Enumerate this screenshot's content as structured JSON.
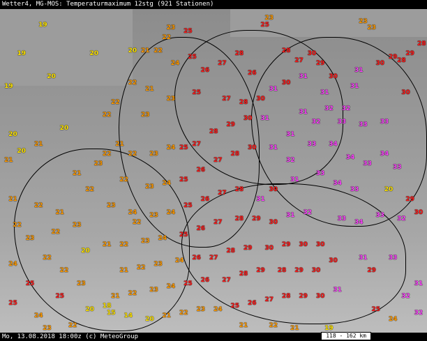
{
  "header": {
    "title": "Wetter4, MG-MOS: Temperaturmaximum 12stg (921 Stationen)"
  },
  "footer": {
    "timestamp": "Mo, 13.08.2018 18:00z (c) MeteoGroup",
    "scale": "118 - 162 km"
  },
  "colors": {
    "cool": "#ffe400",
    "warm": "#ff9a00",
    "hot": "#ff1a1a",
    "very_hot": "#ff44ff"
  },
  "stations": [
    [
      "19",
      0.09,
      0.04
    ],
    [
      "19",
      0.04,
      0.13
    ],
    [
      "20",
      0.21,
      0.13
    ],
    [
      "20",
      0.3,
      0.12
    ],
    [
      "21",
      0.33,
      0.12
    ],
    [
      "19",
      0.01,
      0.23
    ],
    [
      "20",
      0.11,
      0.2
    ],
    [
      "20",
      0.02,
      0.38
    ],
    [
      "21",
      0.01,
      0.46
    ],
    [
      "20",
      0.04,
      0.43
    ],
    [
      "21",
      0.08,
      0.41
    ],
    [
      "20",
      0.14,
      0.36
    ],
    [
      "22",
      0.24,
      0.32
    ],
    [
      "23",
      0.33,
      0.32
    ],
    [
      "21",
      0.17,
      0.5
    ],
    [
      "22",
      0.2,
      0.55
    ],
    [
      "23",
      0.25,
      0.6
    ],
    [
      "24",
      0.3,
      0.62
    ],
    [
      "22",
      0.38,
      0.08
    ],
    [
      "23",
      0.39,
      0.05
    ],
    [
      "25",
      0.43,
      0.06
    ],
    [
      "22",
      0.36,
      0.12
    ],
    [
      "24",
      0.4,
      0.16
    ],
    [
      "25",
      0.44,
      0.14
    ],
    [
      "26",
      0.47,
      0.18
    ],
    [
      "27",
      0.51,
      0.16
    ],
    [
      "28",
      0.55,
      0.13
    ],
    [
      "26",
      0.58,
      0.19
    ],
    [
      "25",
      0.61,
      0.04
    ],
    [
      "23",
      0.62,
      0.02
    ],
    [
      "28",
      0.66,
      0.12
    ],
    [
      "27",
      0.69,
      0.15
    ],
    [
      "30",
      0.72,
      0.13
    ],
    [
      "29",
      0.74,
      0.16
    ],
    [
      "30",
      0.77,
      0.2
    ],
    [
      "31",
      0.83,
      0.18
    ],
    [
      "30",
      0.88,
      0.16
    ],
    [
      "29",
      0.91,
      0.14
    ],
    [
      "28",
      0.93,
      0.15
    ],
    [
      "29",
      0.95,
      0.13
    ],
    [
      "28",
      0.98,
      0.1
    ],
    [
      "23",
      0.84,
      0.03
    ],
    [
      "23",
      0.86,
      0.05
    ],
    [
      "31",
      0.7,
      0.2
    ],
    [
      "30",
      0.66,
      0.22
    ],
    [
      "31",
      0.63,
      0.24
    ],
    [
      "30",
      0.6,
      0.27
    ],
    [
      "28",
      0.56,
      0.28
    ],
    [
      "27",
      0.52,
      0.27
    ],
    [
      "25",
      0.45,
      0.25
    ],
    [
      "23",
      0.39,
      0.27
    ],
    [
      "21",
      0.34,
      0.24
    ],
    [
      "22",
      0.3,
      0.22
    ],
    [
      "22",
      0.26,
      0.28
    ],
    [
      "31",
      0.75,
      0.25
    ],
    [
      "32",
      0.76,
      0.3
    ],
    [
      "32",
      0.8,
      0.3
    ],
    [
      "33",
      0.79,
      0.34
    ],
    [
      "33",
      0.84,
      0.35
    ],
    [
      "33",
      0.89,
      0.34
    ],
    [
      "30",
      0.94,
      0.25
    ],
    [
      "31",
      0.82,
      0.23
    ],
    [
      "32",
      0.73,
      0.34
    ],
    [
      "31",
      0.7,
      0.31
    ],
    [
      "31",
      0.61,
      0.33
    ],
    [
      "30",
      0.57,
      0.33
    ],
    [
      "29",
      0.53,
      0.35
    ],
    [
      "28",
      0.49,
      0.37
    ],
    [
      "27",
      0.45,
      0.41
    ],
    [
      "25",
      0.42,
      0.42
    ],
    [
      "24",
      0.39,
      0.42
    ],
    [
      "23",
      0.35,
      0.44
    ],
    [
      "22",
      0.3,
      0.44
    ],
    [
      "21",
      0.27,
      0.41
    ],
    [
      "22",
      0.24,
      0.44
    ],
    [
      "23",
      0.22,
      0.47
    ],
    [
      "31",
      0.67,
      0.38
    ],
    [
      "33",
      0.72,
      0.41
    ],
    [
      "34",
      0.77,
      0.41
    ],
    [
      "34",
      0.81,
      0.45
    ],
    [
      "33",
      0.85,
      0.47
    ],
    [
      "34",
      0.89,
      0.44
    ],
    [
      "33",
      0.92,
      0.48
    ],
    [
      "32",
      0.67,
      0.46
    ],
    [
      "31",
      0.63,
      0.42
    ],
    [
      "30",
      0.58,
      0.42
    ],
    [
      "28",
      0.54,
      0.44
    ],
    [
      "27",
      0.5,
      0.46
    ],
    [
      "26",
      0.46,
      0.49
    ],
    [
      "25",
      0.42,
      0.52
    ],
    [
      "24",
      0.38,
      0.53
    ],
    [
      "23",
      0.34,
      0.54
    ],
    [
      "22",
      0.28,
      0.52
    ],
    [
      "33",
      0.74,
      0.5
    ],
    [
      "34",
      0.78,
      0.53
    ],
    [
      "33",
      0.82,
      0.55
    ],
    [
      "31",
      0.68,
      0.52
    ],
    [
      "30",
      0.63,
      0.55
    ],
    [
      "31",
      0.6,
      0.58
    ],
    [
      "28",
      0.55,
      0.55
    ],
    [
      "27",
      0.51,
      0.56
    ],
    [
      "26",
      0.47,
      0.58
    ],
    [
      "25",
      0.43,
      0.6
    ],
    [
      "24",
      0.39,
      0.62
    ],
    [
      "23",
      0.35,
      0.63
    ],
    [
      "22",
      0.31,
      0.65
    ],
    [
      "20",
      0.9,
      0.55
    ],
    [
      "33",
      0.79,
      0.64
    ],
    [
      "34",
      0.83,
      0.65
    ],
    [
      "32",
      0.71,
      0.62
    ],
    [
      "31",
      0.67,
      0.63
    ],
    [
      "30",
      0.63,
      0.65
    ],
    [
      "29",
      0.59,
      0.64
    ],
    [
      "28",
      0.55,
      0.64
    ],
    [
      "27",
      0.5,
      0.65
    ],
    [
      "26",
      0.46,
      0.67
    ],
    [
      "25",
      0.42,
      0.69
    ],
    [
      "24",
      0.37,
      0.7
    ],
    [
      "23",
      0.33,
      0.71
    ],
    [
      "22",
      0.28,
      0.72
    ],
    [
      "21",
      0.24,
      0.72
    ],
    [
      "20",
      0.19,
      0.74
    ],
    [
      "33",
      0.88,
      0.63
    ],
    [
      "32",
      0.93,
      0.64
    ],
    [
      "30",
      0.74,
      0.72
    ],
    [
      "30",
      0.7,
      0.72
    ],
    [
      "29",
      0.66,
      0.72
    ],
    [
      "30",
      0.62,
      0.73
    ],
    [
      "29",
      0.57,
      0.73
    ],
    [
      "28",
      0.53,
      0.74
    ],
    [
      "27",
      0.49,
      0.76
    ],
    [
      "26",
      0.45,
      0.76
    ],
    [
      "24",
      0.41,
      0.77
    ],
    [
      "23",
      0.36,
      0.78
    ],
    [
      "22",
      0.32,
      0.79
    ],
    [
      "21",
      0.28,
      0.8
    ],
    [
      "30",
      0.77,
      0.77
    ],
    [
      "31",
      0.84,
      0.76
    ],
    [
      "33",
      0.91,
      0.76
    ],
    [
      "29",
      0.86,
      0.8
    ],
    [
      "30",
      0.73,
      0.8
    ],
    [
      "29",
      0.69,
      0.8
    ],
    [
      "28",
      0.65,
      0.8
    ],
    [
      "29",
      0.6,
      0.8
    ],
    [
      "28",
      0.56,
      0.81
    ],
    [
      "27",
      0.52,
      0.83
    ],
    [
      "26",
      0.47,
      0.83
    ],
    [
      "25",
      0.43,
      0.84
    ],
    [
      "24",
      0.39,
      0.85
    ],
    [
      "23",
      0.35,
      0.86
    ],
    [
      "22",
      0.3,
      0.87
    ],
    [
      "21",
      0.26,
      0.88
    ],
    [
      "18",
      0.24,
      0.91
    ],
    [
      "15",
      0.25,
      0.93
    ],
    [
      "14",
      0.29,
      0.94
    ],
    [
      "20",
      0.2,
      0.92
    ],
    [
      "31",
      0.78,
      0.86
    ],
    [
      "30",
      0.74,
      0.88
    ],
    [
      "29",
      0.7,
      0.88
    ],
    [
      "28",
      0.66,
      0.88
    ],
    [
      "27",
      0.62,
      0.89
    ],
    [
      "26",
      0.58,
      0.9
    ],
    [
      "25",
      0.54,
      0.91
    ],
    [
      "24",
      0.5,
      0.92
    ],
    [
      "23",
      0.46,
      0.92
    ],
    [
      "22",
      0.42,
      0.93
    ],
    [
      "21",
      0.38,
      0.94
    ],
    [
      "20",
      0.34,
      0.95
    ],
    [
      "25",
      0.87,
      0.92
    ],
    [
      "24",
      0.91,
      0.95
    ],
    [
      "19",
      0.76,
      0.99
    ],
    [
      "21",
      0.68,
      0.98
    ],
    [
      "22",
      0.63,
      0.97
    ],
    [
      "21",
      0.56,
      0.97
    ],
    [
      "23",
      0.18,
      0.84
    ],
    [
      "22",
      0.14,
      0.8
    ],
    [
      "22",
      0.1,
      0.76
    ],
    [
      "23",
      0.06,
      0.7
    ],
    [
      "22",
      0.03,
      0.66
    ],
    [
      "21",
      0.02,
      0.58
    ],
    [
      "22",
      0.08,
      0.6
    ],
    [
      "21",
      0.13,
      0.62
    ],
    [
      "22",
      0.12,
      0.68
    ],
    [
      "23",
      0.17,
      0.66
    ],
    [
      "24",
      0.02,
      0.78
    ],
    [
      "25",
      0.06,
      0.84
    ],
    [
      "25",
      0.02,
      0.9
    ],
    [
      "24",
      0.08,
      0.94
    ],
    [
      "25",
      0.13,
      0.88
    ],
    [
      "23",
      0.1,
      0.98
    ],
    [
      "22",
      0.16,
      0.97
    ],
    [
      "31",
      0.97,
      0.84
    ],
    [
      "32",
      0.94,
      0.88
    ],
    [
      "32",
      0.97,
      0.93
    ],
    [
      "29",
      0.95,
      0.58
    ],
    [
      "30",
      0.97,
      0.62
    ]
  ]
}
